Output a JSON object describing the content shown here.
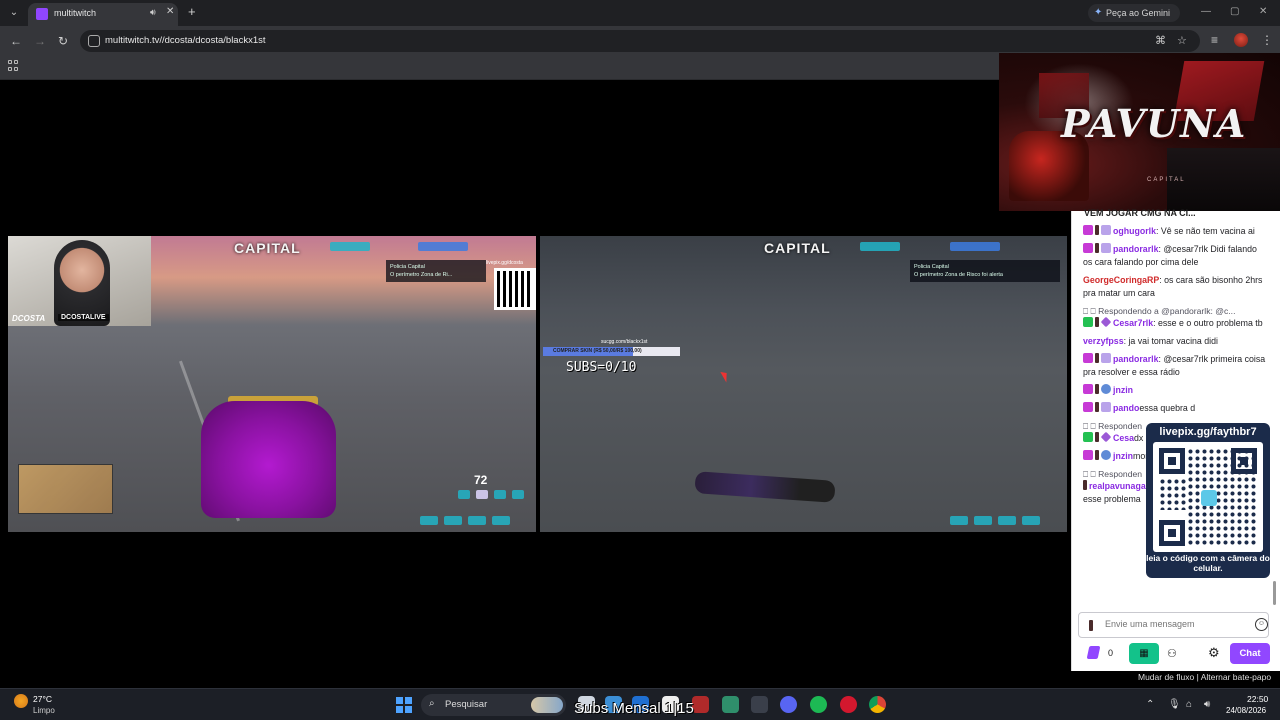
{
  "browser": {
    "tab_title": "multitwitch",
    "gemini_label": "Peça ao Gemini",
    "url": "multitwitch.tv//dcosta/dcosta/blackx1st"
  },
  "banner": {
    "title": "PAVUNA",
    "subtitle": "CAPITAL"
  },
  "stream1": {
    "webcam_name": "DCOSTA",
    "webcam_tag": "DCOSTALIVE",
    "logo": "CAPITAL",
    "hud_box": "Policia Capital\nO perímetro Zona de Ri...",
    "qr_label": "livepix.gg/dcosta",
    "speed": "72"
  },
  "stream2": {
    "logo": "CAPITAL",
    "hud_box": "Policia Capital\nO perímetro Zona de Risco foi alerta",
    "subs_bar_top": "sucgg.com/blackx1st",
    "subs_bar_text": "COMPRAR SKIN (R$ 50,00/R$ 100,00)",
    "subs_bar_progress": 0.66,
    "subs_counter": "SUBS=0/10"
  },
  "chat": {
    "header_crop": "VEM JOGAR CMG NA CI...",
    "messages": [
      {
        "user": "oghugorlk",
        "color": "#8a2be2",
        "text": ": Vê se não tem vacina ai"
      },
      {
        "user": "pandorarlk",
        "color": "#8a2be2",
        "text": ": @cesar7rlk Didi falando os cara falando por cima dele"
      },
      {
        "user": "GeorgeCoringaRP",
        "color": "#d02b2b",
        "text": ": os cara são bisonho 2hrs pra matar um cara"
      },
      {
        "reply": "Respondendo a @pandorarlk: @c...",
        "user": "Cesar7rlk",
        "color": "#8a2be2",
        "text": ": esse e o outro problema tb"
      },
      {
        "user": "verzyfpss",
        "color": "#8a2be2",
        "text": ": ja vai tomar vacina didi"
      },
      {
        "user": "pandorarlk",
        "color": "#8a2be2",
        "text": ": @cesar7rlk primeira coisa pra resolver e essa rádio"
      },
      {
        "user": "jnzin",
        "color": "#8a2be2",
        "text": ""
      },
      {
        "user": "pando",
        "color": "#8a2be2",
        "text": "essa quebra d"
      },
      {
        "reply": "Responden",
        "user": "Cesa",
        "color": "#8a2be2",
        "text": "dx so os geren"
      },
      {
        "user": "jnzin",
        "color": "#8a2be2",
        "text": "morada"
      },
      {
        "reply": "Responden",
        "user": "realpavunagang",
        "color": "#8a2be2",
        "text": ": Pior que todas as fac tem esse problema"
      }
    ],
    "qr_url": "livepix.gg/faythbr7",
    "qr_caption": "leia o código com a câmera do celular.",
    "input_placeholder": "Envie uma mensagem",
    "points": "0",
    "chat_button": "Chat",
    "footer": "Mudar de fluxo | Alternar bate-papo"
  },
  "taskbar": {
    "temp": "27°C",
    "condition": "Limpo",
    "search_placeholder": "Pesquisar",
    "overlay_text": "Subs Mensal 1|15",
    "time": "22:50",
    "date": "24/08/2026"
  },
  "colors": {
    "twitch_purple": "#9147ff",
    "cal_green": "#13c28a",
    "qr_navy": "#1b2b4a"
  }
}
